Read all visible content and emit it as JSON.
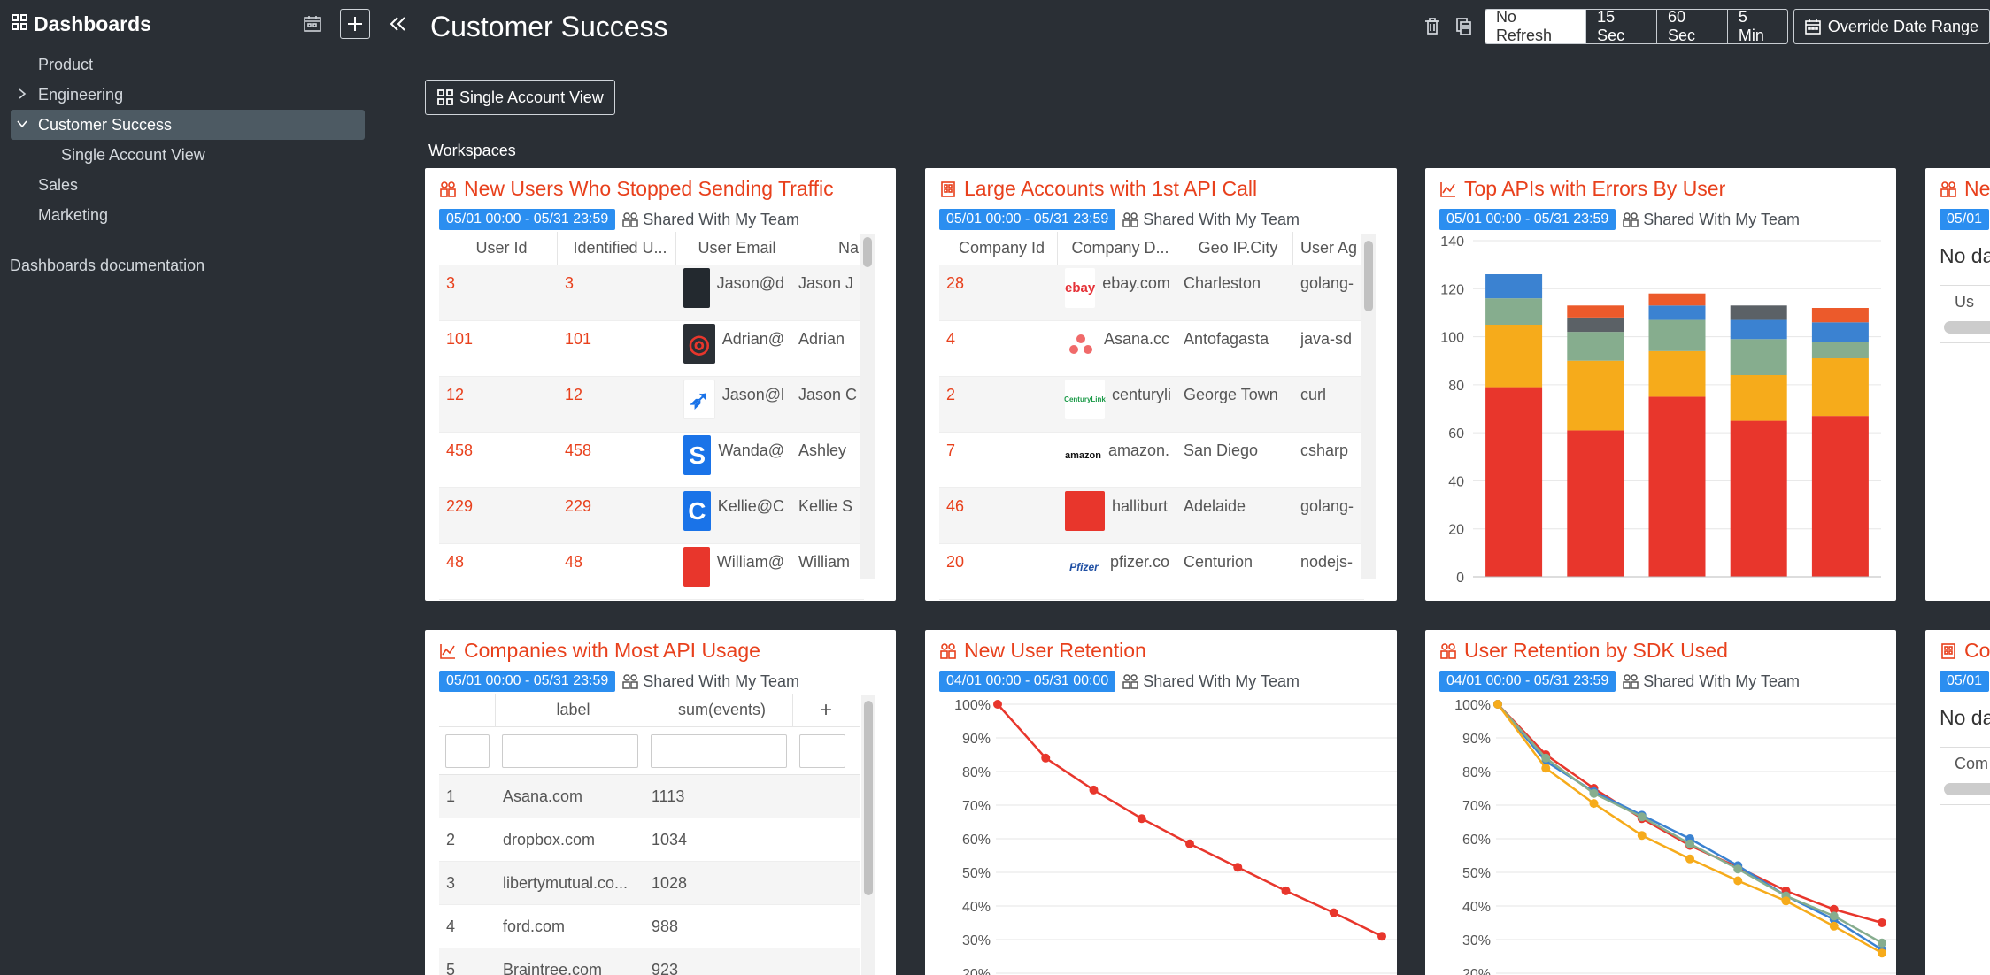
{
  "sidebar": {
    "title": "Dashboards",
    "items": [
      {
        "label": "Product"
      },
      {
        "label": "Engineering"
      },
      {
        "label": "Customer Success"
      },
      {
        "label": "Single Account View"
      },
      {
        "label": "Sales"
      },
      {
        "label": "Marketing"
      }
    ],
    "doc_link": "Dashboards documentation"
  },
  "header": {
    "title": "Customer Success",
    "refresh_options": [
      "No Refresh",
      "15 Sec",
      "60 Sec",
      "5 Min"
    ],
    "selected_refresh": "No Refresh",
    "override_label": "Override Date Range"
  },
  "single_account_button": "Single Account View",
  "workspaces_label": "Workspaces",
  "shared_label": "Shared With My Team",
  "cards": {
    "new_users_stopped": {
      "title": "New Users Who Stopped Sending Traffic",
      "date_range": "05/01 00:00 - 05/31 23:59",
      "columns": [
        "User Id",
        "Identified U...",
        "User Email",
        "Nar"
      ],
      "rows": [
        {
          "id": "3",
          "identified": "3",
          "email": "Jason@d",
          "name": "Jason J",
          "logo": "dark"
        },
        {
          "id": "101",
          "identified": "101",
          "email": "Adrian@",
          "name": "Adrian",
          "logo": "target"
        },
        {
          "id": "12",
          "identified": "12",
          "email": "Jason@l",
          "name": "Jason C",
          "logo": "bird"
        },
        {
          "id": "458",
          "identified": "458",
          "email": "Wanda@",
          "name": "Ashley",
          "logo": "s"
        },
        {
          "id": "229",
          "identified": "229",
          "email": "Kellie@C",
          "name": "Kellie S",
          "logo": "c"
        },
        {
          "id": "48",
          "identified": "48",
          "email": "William@",
          "name": "William",
          "logo": "red"
        }
      ]
    },
    "large_accounts": {
      "title": "Large Accounts with 1st API Call",
      "date_range": "05/01 00:00 - 05/31 23:59",
      "columns": [
        "Company Id",
        "Company D...",
        "Geo IP.City",
        "User Ag"
      ],
      "rows": [
        {
          "id": "28",
          "domain": "ebay.com",
          "city": "Charleston",
          "agent": "golang-",
          "logo_text": "ebay"
        },
        {
          "id": "4",
          "domain": "Asana.cc",
          "city": "Antofagasta",
          "agent": "java-sd",
          "logo_text": ""
        },
        {
          "id": "2",
          "domain": "centuryli",
          "city": "George Town",
          "agent": "curl",
          "logo_text": "CenturyLink"
        },
        {
          "id": "7",
          "domain": "amazon.",
          "city": "San Diego",
          "agent": "csharp",
          "logo_text": "amazon"
        },
        {
          "id": "46",
          "domain": "halliburt",
          "city": "Adelaide",
          "agent": "golang-",
          "logo_text": ""
        },
        {
          "id": "20",
          "domain": "pfizer.co",
          "city": "Centurion",
          "agent": "nodejs-",
          "logo_text": "Pfizer"
        }
      ]
    },
    "top_apis": {
      "title": "Top APIs with Errors By User",
      "date_range": "05/01 00:00 - 05/31 23:59"
    },
    "companies_api": {
      "title": "Companies with Most API Usage",
      "date_range": "05/01 00:00 - 05/31 23:59",
      "columns": [
        "label",
        "sum(events)"
      ],
      "add_symbol": "+",
      "rows": [
        {
          "n": "1",
          "label": "Asana.com",
          "value": "1113"
        },
        {
          "n": "2",
          "label": "dropbox.com",
          "value": "1034"
        },
        {
          "n": "3",
          "label": "libertymutual.co...",
          "value": "1028"
        },
        {
          "n": "4",
          "label": "ford.com",
          "value": "988"
        },
        {
          "n": "5",
          "label": "Braintree.com",
          "value": "923"
        }
      ]
    },
    "new_user_retention": {
      "title": "New User Retention",
      "date_range": "04/01 00:00 - 05/31 00:00"
    },
    "retention_sdk": {
      "title": "User Retention by SDK Used",
      "date_range": "04/01 00:00 - 05/31 23:59"
    },
    "partial_top": {
      "title": "Ne",
      "date_range": "05/01",
      "message": "No da",
      "column": "Us"
    },
    "partial_bottom": {
      "title": "Co",
      "date_range": "05/01",
      "message": "No da",
      "column": "Com"
    }
  },
  "chart_data": [
    {
      "type": "bar",
      "stacked": true,
      "title": "Top APIs with Errors By User",
      "categories": [
        "",
        "",
        "",
        "",
        ""
      ],
      "series": [
        {
          "color": "#e8362c",
          "values": [
            79,
            61,
            75,
            65,
            67
          ]
        },
        {
          "color": "#f6ab1b",
          "values": [
            26,
            29,
            19,
            19,
            24
          ]
        },
        {
          "color": "#86ad8e",
          "values": [
            11,
            12,
            13,
            15,
            7
          ]
        },
        {
          "color": "#3b82d1",
          "values": [
            10,
            0,
            6,
            8,
            8
          ]
        },
        {
          "color": "#5b6166",
          "values": [
            0,
            6,
            0,
            6,
            0
          ]
        },
        {
          "color": "#ec5a2b",
          "values": [
            0,
            5,
            5,
            0,
            6
          ]
        }
      ],
      "ylim": [
        0,
        140
      ],
      "yticks": [
        0,
        20,
        40,
        60,
        80,
        100,
        120,
        140
      ],
      "grid": true
    },
    {
      "type": "line",
      "title": "New User Retention",
      "x": [
        0,
        1,
        2,
        3,
        4,
        5,
        6,
        7,
        8
      ],
      "series": [
        {
          "color": "#e8362c",
          "values": [
            100,
            84,
            74.5,
            66,
            58.5,
            51.5,
            44.5,
            38,
            31
          ]
        }
      ],
      "yticks": [
        "100%",
        "90%",
        "80%",
        "70%",
        "60%",
        "50%",
        "40%",
        "30%",
        "20%"
      ],
      "ylim": [
        20,
        100
      ],
      "grid": true
    },
    {
      "type": "line",
      "title": "User Retention by SDK Used",
      "x": [
        0,
        1,
        2,
        3,
        4,
        5,
        6,
        7,
        8
      ],
      "series": [
        {
          "color": "#e8362c",
          "values": [
            100,
            85,
            75,
            66,
            58,
            51.5,
            44.5,
            39,
            35
          ]
        },
        {
          "color": "#3b82d1",
          "values": [
            100,
            83,
            74,
            67,
            60,
            52,
            43,
            36,
            27
          ]
        },
        {
          "color": "#86ad8e",
          "values": [
            100,
            84,
            73.5,
            66.5,
            58.5,
            51,
            43,
            37,
            29
          ]
        },
        {
          "color": "#f6ab1b",
          "values": [
            100,
            81,
            70.5,
            61,
            54,
            47.5,
            41.5,
            34,
            26
          ]
        }
      ],
      "yticks": [
        "100%",
        "90%",
        "80%",
        "70%",
        "60%",
        "50%",
        "40%",
        "30%",
        "20%"
      ],
      "ylim": [
        20,
        100
      ],
      "grid": true
    }
  ]
}
